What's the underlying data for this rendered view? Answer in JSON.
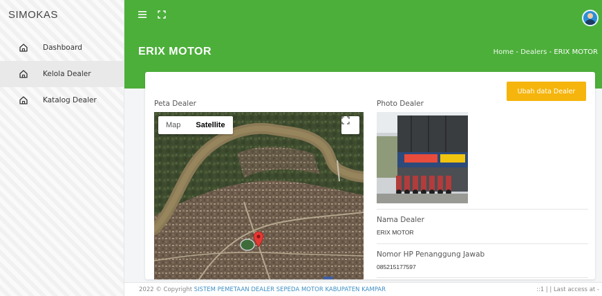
{
  "app": {
    "brand": "SIMOKAS"
  },
  "sidebar": {
    "items": [
      {
        "label": "Dashboard",
        "icon": "home-icon"
      },
      {
        "label": "Kelola Dealer",
        "icon": "home-icon",
        "active": true
      },
      {
        "label": "Katalog Dealer",
        "icon": "home-icon"
      }
    ]
  },
  "header": {
    "menu_icon": "hamburger-icon",
    "fullscreen_icon": "expand-icon",
    "avatar_icon": "user-avatar-icon",
    "title": "ERIX MOTOR",
    "breadcrumb": {
      "home": "Home",
      "sep": "-",
      "dealers": "Dealers",
      "current": "ERIX MOTOR"
    },
    "accent_color": "#4caf3a"
  },
  "card": {
    "edit_button": "Ubah data Dealer",
    "edit_button_color": "#f5b50c",
    "map_label": "Peta Dealer",
    "photo_label": "Photo Dealer",
    "map": {
      "tab_map": "Map",
      "tab_satellite": "Satellite",
      "active_tab": "Satellite",
      "marker_icon": "map-pin-icon",
      "marker_color": "#e53935"
    },
    "fields": [
      {
        "label": "Nama Dealer",
        "value": "ERIX MOTOR"
      },
      {
        "label": "Nomor HP Penanggung Jawab",
        "value": "085215177597"
      }
    ]
  },
  "footer": {
    "copy_prefix": "2022 © Copyright",
    "copy_link": "SISTEM PEMETAAN DEALER SEPEDA MOTOR KABUPATEN KAMPAR",
    "access": "::1 | | Last access at -"
  }
}
